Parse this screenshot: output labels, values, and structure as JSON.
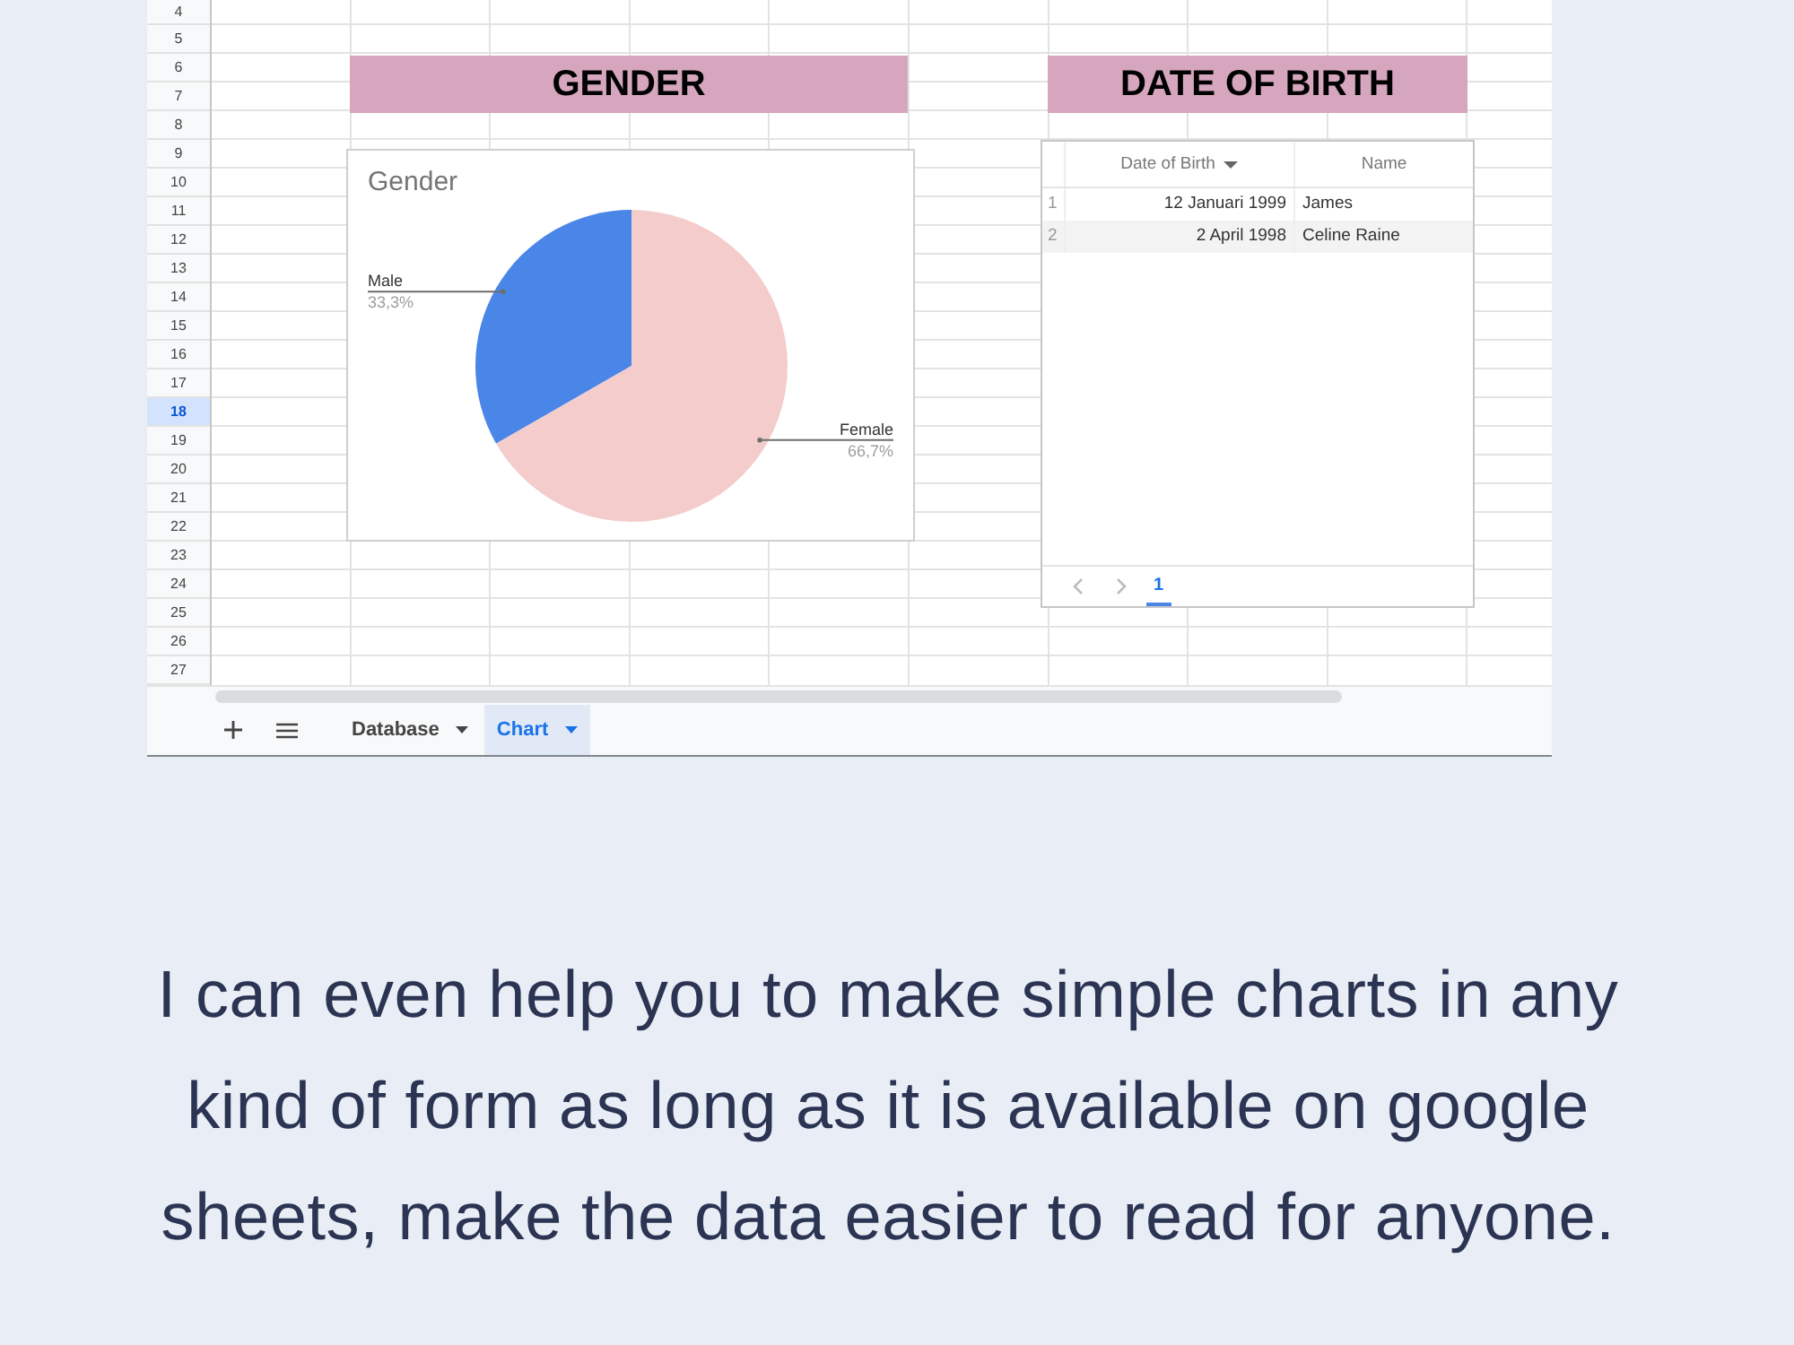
{
  "sheet": {
    "row_numbers": [
      {
        "label": "4",
        "selected": false
      },
      {
        "label": "5",
        "selected": false
      },
      {
        "label": "6",
        "selected": false
      },
      {
        "label": "7",
        "selected": false
      },
      {
        "label": "8",
        "selected": false
      },
      {
        "label": "9",
        "selected": false
      },
      {
        "label": "10",
        "selected": false
      },
      {
        "label": "11",
        "selected": false
      },
      {
        "label": "12",
        "selected": false
      },
      {
        "label": "13",
        "selected": false
      },
      {
        "label": "14",
        "selected": false
      },
      {
        "label": "15",
        "selected": false
      },
      {
        "label": "16",
        "selected": false
      },
      {
        "label": "17",
        "selected": false
      },
      {
        "label": "18",
        "selected": true
      },
      {
        "label": "19",
        "selected": false
      },
      {
        "label": "20",
        "selected": false
      },
      {
        "label": "21",
        "selected": false
      },
      {
        "label": "22",
        "selected": false
      },
      {
        "label": "23",
        "selected": false
      },
      {
        "label": "24",
        "selected": false
      },
      {
        "label": "25",
        "selected": false
      },
      {
        "label": "26",
        "selected": false
      },
      {
        "label": "27",
        "selected": false
      }
    ],
    "section_headers": [
      "GENDER",
      "DATE OF BIRTH"
    ],
    "gender_chart": {
      "chart_data": {
        "type": "pie",
        "title": "Gender",
        "categories": [
          "Male",
          "Female"
        ],
        "values": [
          33.3,
          66.7
        ],
        "colors": [
          "#4a86e8",
          "#f4cccc"
        ],
        "value_labels": [
          "33,3%",
          "66,7%"
        ]
      }
    },
    "dob_table": {
      "columns": [
        {
          "label": "Date of Birth",
          "sorted": true
        },
        {
          "label": "Name",
          "sorted": false
        }
      ],
      "rows": [
        {
          "number": "1",
          "cells": [
            "12 Januari 1999",
            "James"
          ]
        },
        {
          "number": "2",
          "cells": [
            "2 April 1998",
            "Celine Raine"
          ]
        }
      ],
      "pages": [
        {
          "label": "1",
          "selected": true
        }
      ]
    },
    "sheet_tabs": [
      {
        "label": "Database",
        "selected": false
      },
      {
        "label": "Chart",
        "selected": true
      }
    ]
  },
  "caption": "I can even help you to make simple charts in any kind of form as long as it is available on google sheets, make the data easier to read for anyone."
}
